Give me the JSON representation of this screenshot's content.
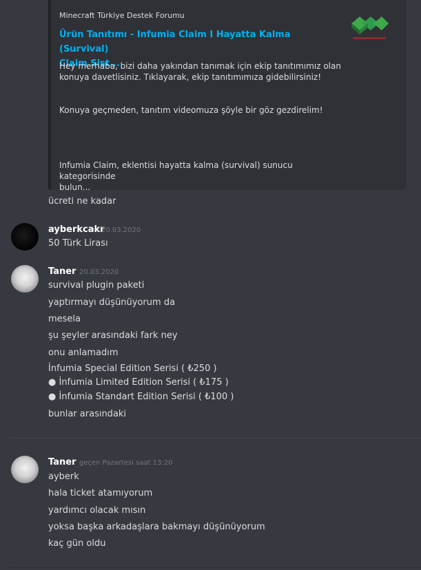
{
  "embed": {
    "provider": "Minecraft Türkiye Destek Forumu",
    "title_line1": "Ürün Tanıtımı - Infumia Claim I Hayatta Kalma (Survival)",
    "title_line2": "Claim Sist...",
    "desc_1a": "Hey merhaba, bizi daha yakından tanımak için ekip tanıtımımız olan",
    "desc_1b": "konuya davetlisiniz. Tıklayarak, ekip tanıtımımıza gidebilirsiniz!",
    "desc_2": "Konuya geçmeden, tanıtım videomuza şöyle bir göz gezdirelim!",
    "desc_3a": "Infumia Claim, eklentisi hayatta kalma (survival) sunucu kategorisinde",
    "desc_3b": "bulun...",
    "thumbnail_icon": "minecraft-logo-icon"
  },
  "messages": {
    "m0_line": "ücreti ne kadar",
    "m1": {
      "author": "ayberkcakr",
      "timestamp": "20.03.2020",
      "line": "50 Türk Lirası"
    },
    "m2": {
      "author": "Taner",
      "timestamp": "20.03.2020",
      "lines": [
        "survival plugin paketi",
        "yaptırmayı düşünüyorum da",
        "mesela",
        "şu şeyler arasındaki fark ney",
        "onu anlamadım",
        "İnfumia Special Edition Serisi ( ₺250 )",
        "● İnfumia Limited Edition Serisi ( ₺175 )",
        "● İnfumia Standart Edition Serisi ( ₺100 )",
        "bunlar arasındaki"
      ]
    },
    "m3": {
      "author": "Taner",
      "timestamp": "geçen Pazartesi saat 13:20",
      "lines": [
        "ayberk",
        "hala ticket atamıyorum",
        "yardımcı olacak mısın",
        "yoksa başka arkadaşlara bakmayı düşünüyorum",
        "kaç gün oldu"
      ]
    }
  },
  "colors": {
    "background": "#36393f",
    "embed_background": "#2f3136",
    "link": "#00b0f4",
    "author": "#ffffff",
    "timestamp": "#72767d"
  }
}
